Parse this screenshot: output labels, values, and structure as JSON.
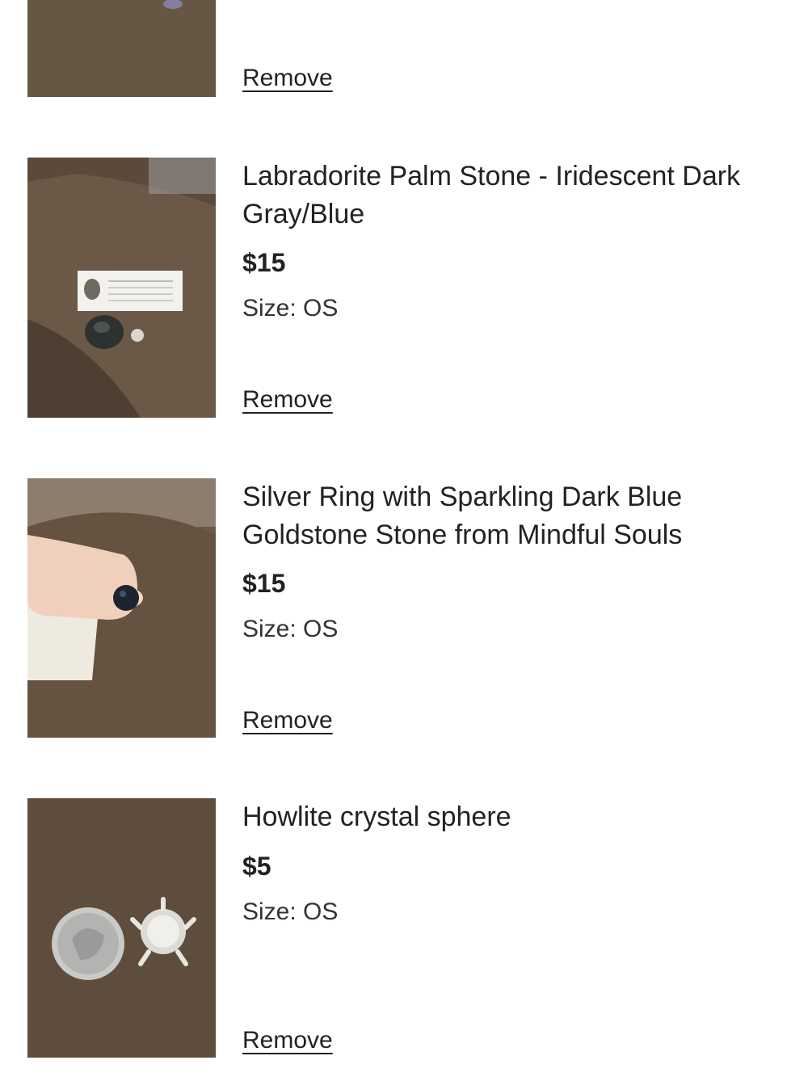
{
  "cart": {
    "items": [
      {
        "image": "brown-fabric-photo",
        "remove_label": "Remove"
      },
      {
        "image": "labradorite-palm-stone-photo",
        "title": "Labradorite Palm Stone - Iridescent Dark Gray/Blue",
        "price": "$15",
        "size": "Size: OS",
        "remove_label": "Remove"
      },
      {
        "image": "silver-ring-goldstone-photo",
        "title": "Silver Ring with Sparkling Dark Blue Goldstone Stone from Mindful Souls",
        "price": "$15",
        "size": "Size: OS",
        "remove_label": "Remove"
      },
      {
        "image": "howlite-sphere-photo",
        "title": "Howlite crystal sphere",
        "price": "$5",
        "size": "Size: OS",
        "remove_label": "Remove"
      }
    ]
  }
}
